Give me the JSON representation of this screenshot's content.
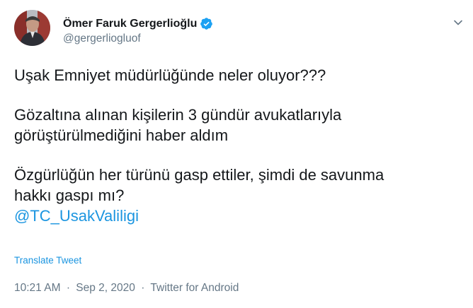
{
  "author": {
    "name": "Ömer Faruk Gergerlioğlu",
    "handle": "@gergerliogluof"
  },
  "tweet": {
    "paragraphs": [
      "Uşak Emniyet müdürlüğünde neler oluyor???",
      [
        "Gözaltına alınan kişilerin 3 gündür avukatlarıyla",
        "görüştürülmediğini haber aldım"
      ],
      [
        "Özgürlüğün her türünü gasp ettiler, şimdi de savunma",
        "hakkı gaspı mı?"
      ]
    ],
    "mention": "@TC_UsakValiligi",
    "translate_label": "Translate Tweet",
    "time": "10:21 AM",
    "separator1": "·",
    "date": "Sep 2, 2020",
    "separator2": "·",
    "source": "Twitter for Android"
  },
  "icons": {
    "verified": "verified-badge-icon",
    "menu": "chevron-down-icon"
  },
  "colors": {
    "link": "#1b95e0",
    "verified": "#1da1f2",
    "secondary_text": "#657786"
  }
}
